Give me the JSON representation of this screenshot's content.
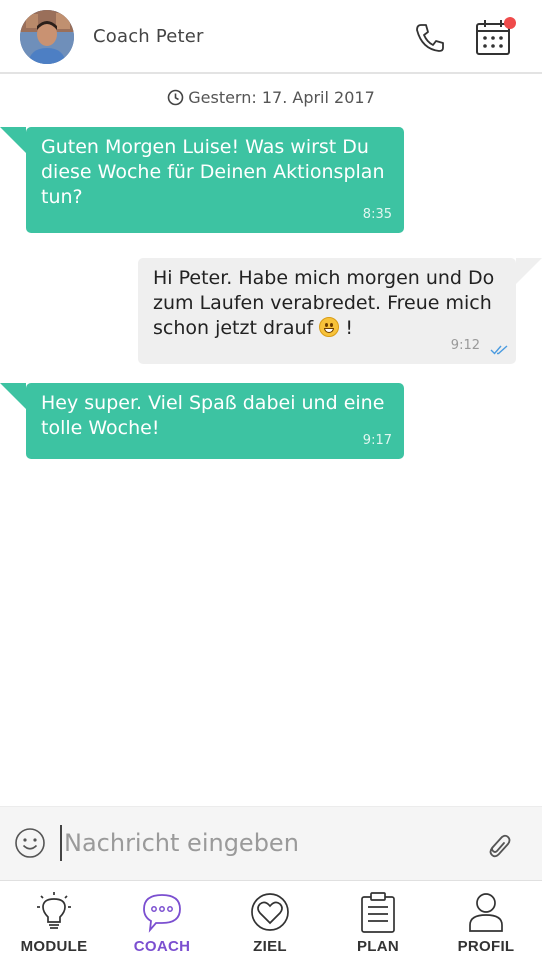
{
  "header": {
    "coach_name": "Coach Peter",
    "calendar_badge_color": "#ef4b4b"
  },
  "chat": {
    "date_label": "Gestern: 17. April 2017",
    "messages": [
      {
        "direction": "incoming",
        "text": "Guten Morgen Luise! Was wirst Du diese Woche für Deinen Aktionsplan tun?",
        "time": "8:35"
      },
      {
        "direction": "outgoing",
        "text": "Hi Peter. Habe mich morgen und Do zum Laufen verabredet. Freue mich schon jetzt drauf",
        "suffix": "!",
        "emoji": "grinning-face",
        "time": "9:12",
        "status": "read"
      },
      {
        "direction": "incoming",
        "text": "Hey super. Viel Spaß dabei und eine tolle Woche!",
        "time": "9:17"
      }
    ]
  },
  "composer": {
    "placeholder": "Nachricht eingeben",
    "value": ""
  },
  "tabs": [
    {
      "label": "MODULE",
      "icon": "lightbulb-icon",
      "active": false
    },
    {
      "label": "COACH",
      "icon": "chat-bubble-icon",
      "active": true
    },
    {
      "label": "ZIEL",
      "icon": "heart-target-icon",
      "active": false
    },
    {
      "label": "PLAN",
      "icon": "clipboard-icon",
      "active": false
    },
    {
      "label": "PROFIL",
      "icon": "person-icon",
      "active": false
    }
  ],
  "colors": {
    "accent": "#3dc3a2",
    "active_tab": "#7b4fd0",
    "outgoing_bubble": "#efefef"
  }
}
